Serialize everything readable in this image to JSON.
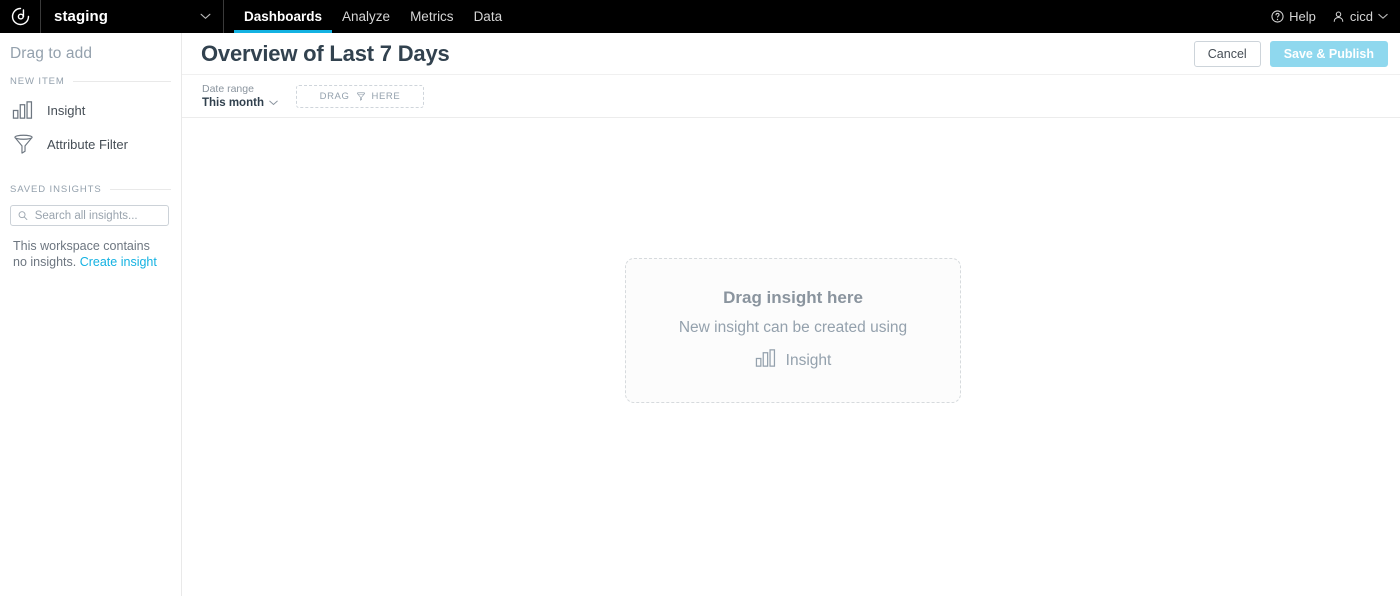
{
  "topnav": {
    "logo_icon": "gooddata-logo-icon",
    "workspace": {
      "name": "staging",
      "chevron_icon": "chevron-down-icon"
    },
    "tabs": [
      {
        "label": "Dashboards",
        "active": true
      },
      {
        "label": "Analyze",
        "active": false
      },
      {
        "label": "Metrics",
        "active": false
      },
      {
        "label": "Data",
        "active": false
      }
    ],
    "help": {
      "label": "Help",
      "icon": "question-circle-icon"
    },
    "user": {
      "label": "cicd",
      "icon": "user-icon",
      "chevron_icon": "chevron-down-icon"
    },
    "accent_color": "#14b2e2"
  },
  "sidebar": {
    "heading": "Drag to add",
    "new_item_section": "NEW ITEM",
    "new_items": [
      {
        "label": "Insight",
        "icon": "bar-chart-icon"
      },
      {
        "label": "Attribute Filter",
        "icon": "funnel-icon"
      }
    ],
    "saved_insights_section": "SAVED INSIGHTS",
    "search": {
      "placeholder": "Search all insights...",
      "value": "",
      "icon": "search-icon"
    },
    "empty_state": {
      "text": "This workspace contains no insights.",
      "link": "Create insight",
      "link_color": "#14b2e2"
    }
  },
  "main": {
    "page_title": "Overview of Last 7 Days",
    "cancel_label": "Cancel",
    "publish_label": "Save & Publish",
    "publish_color": "#8fd8ee",
    "filter_bar": {
      "date_range_caption": "Date range",
      "date_range_value": "This month",
      "chevron_icon": "chevron-down-icon",
      "drop_target": {
        "text_before": "DRAG",
        "text_after": "HERE",
        "icon": "funnel-icon"
      }
    },
    "dropzone": {
      "title": "Drag insight here",
      "subtitle": "New insight can be created using",
      "item_label": "Insight",
      "item_icon": "bar-chart-icon"
    }
  }
}
